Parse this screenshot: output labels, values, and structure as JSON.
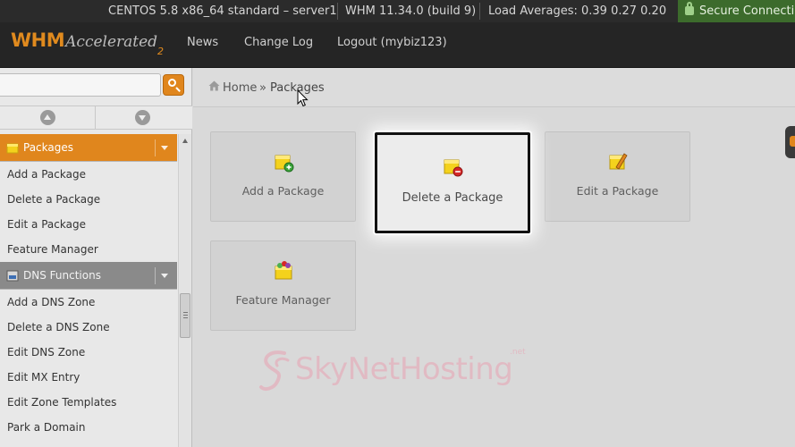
{
  "status_bar": {
    "server": "CENTOS 5.8 x86_64 standard – server1",
    "version": "WHM 11.34.0 (build 9)",
    "load": "Load Averages: 0.39 0.27 0.20",
    "secure": "Secure Connecti"
  },
  "brand": {
    "name": "WHM",
    "tagline": "Accelerated",
    "suffix": "2"
  },
  "nav": {
    "news": "News",
    "changelog": "Change Log",
    "logout": "Logout (mybiz123)"
  },
  "sidebar": {
    "search_value": "",
    "sections": [
      {
        "title": "Packages",
        "items": [
          "Add a Package",
          "Delete a Package",
          "Edit a Package",
          "Feature Manager"
        ]
      },
      {
        "title": "DNS Functions",
        "items": [
          "Add a DNS Zone",
          "Delete a DNS Zone",
          "Edit DNS Zone",
          "Edit MX Entry",
          "Edit Zone Templates",
          "Park a Domain"
        ]
      }
    ]
  },
  "breadcrumb": {
    "home": "Home",
    "sep": "»",
    "current": "Packages"
  },
  "tiles": [
    {
      "label": "Add a Package"
    },
    {
      "label": "Delete a Package"
    },
    {
      "label": "Edit a Package"
    },
    {
      "label": "Feature Manager"
    }
  ],
  "watermark": {
    "text": "SkyNetHosting",
    "suffix": ".net"
  },
  "colors": {
    "accent": "#e0861d",
    "topbar": "#252525",
    "secure": "#3c6b2c",
    "watermark": "#e9a2b2"
  }
}
